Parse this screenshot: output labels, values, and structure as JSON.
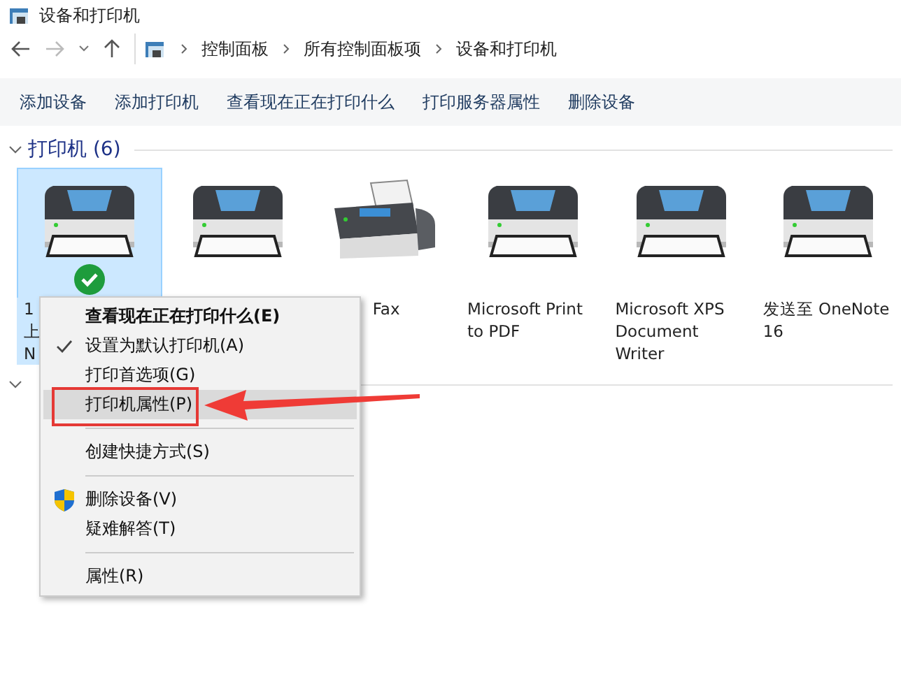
{
  "window": {
    "title": "设备和打印机"
  },
  "breadcrumb": [
    "控制面板",
    "所有控制面板项",
    "设备和打印机"
  ],
  "toolbar": [
    "添加设备",
    "添加打印机",
    "查看现在正在打印什么",
    "打印服务器属性",
    "删除设备"
  ],
  "printers_section": {
    "title": "打印机 (6)",
    "expanded": true
  },
  "printers": [
    {
      "kind": "printer",
      "label_lines": [
        "1",
        "上",
        "N"
      ],
      "selected": true,
      "default": true
    },
    {
      "kind": "printer",
      "selected": false,
      "default": false
    },
    {
      "kind": "fax",
      "label_lines": [
        "Fax"
      ],
      "selected": false,
      "default": false
    },
    {
      "kind": "printer",
      "label_lines": [
        "Microsoft Print",
        "to PDF"
      ],
      "selected": false,
      "default": false
    },
    {
      "kind": "printer",
      "label_lines": [
        "Microsoft XPS",
        "Document",
        "Writer"
      ],
      "selected": false,
      "default": false
    },
    {
      "kind": "printer",
      "label_lines": [
        "发送至 OneNote",
        "16"
      ],
      "selected": false,
      "default": false
    }
  ],
  "devices_section": {
    "expanded": true
  },
  "context_menu": [
    {
      "kind": "default",
      "label": "查看现在正在打印什么(E)",
      "checked": false,
      "selected": false
    },
    {
      "kind": "plain",
      "label": "设置为默认打印机(A)",
      "checked": true,
      "selected": false
    },
    {
      "kind": "plain",
      "label": "打印首选项(G)",
      "checked": false,
      "selected": false
    },
    {
      "kind": "plain",
      "label": "打印机属性(P)",
      "checked": false,
      "selected": true
    },
    {
      "kind": "separator"
    },
    {
      "kind": "plain",
      "label": "创建快捷方式(S)",
      "checked": false,
      "selected": false
    },
    {
      "kind": "separator"
    },
    {
      "kind": "shield",
      "label": "删除设备(V)",
      "checked": false,
      "selected": false
    },
    {
      "kind": "plain",
      "label": "疑难解答(T)",
      "checked": false,
      "selected": false
    },
    {
      "kind": "separator"
    },
    {
      "kind": "plain",
      "label": "属性(R)",
      "checked": false,
      "selected": false
    }
  ]
}
